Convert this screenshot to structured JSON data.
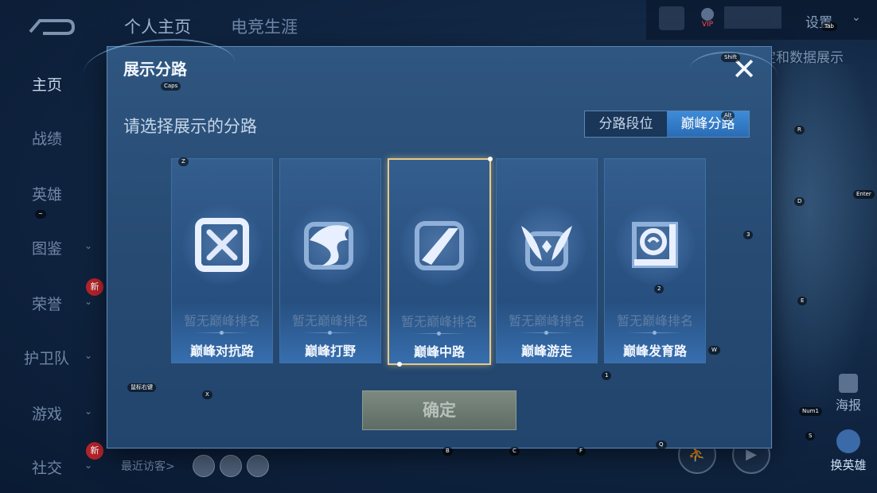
{
  "background": {
    "top_tabs": [
      "个人主页",
      "电竞生涯"
    ],
    "settings_label": "设置",
    "right_snippet": "定和数据展示",
    "sidebar": [
      {
        "label": "主页",
        "active": true,
        "has_chevron": false,
        "new_badge": false
      },
      {
        "label": "战绩",
        "active": false,
        "has_chevron": false,
        "new_badge": false
      },
      {
        "label": "英雄",
        "active": false,
        "has_chevron": false,
        "new_badge": false
      },
      {
        "label": "图鉴",
        "active": false,
        "has_chevron": true,
        "new_badge": false
      },
      {
        "label": "荣誉",
        "active": false,
        "has_chevron": true,
        "new_badge": true
      },
      {
        "label": "护卫队",
        "active": false,
        "has_chevron": true,
        "new_badge": false
      },
      {
        "label": "游戏",
        "active": false,
        "has_chevron": true,
        "new_badge": false
      },
      {
        "label": "社交",
        "active": false,
        "has_chevron": true,
        "new_badge": true
      }
    ],
    "new_badge_text": "新",
    "vip_text": "VIP",
    "visitors_label": "最近访客>",
    "poster_label": "海报",
    "swap_hero_label": "换英雄"
  },
  "dialog": {
    "title": "展示分路",
    "subtitle": "请选择展示的分路",
    "toggle": {
      "options": [
        "分路段位",
        "巅峰分路"
      ],
      "selected_index": 1
    },
    "cards": [
      {
        "name": "巅峰对抗路",
        "rank_text": "暂无巅峰排名",
        "icon": "clash-lane-icon",
        "selected": false
      },
      {
        "name": "巅峰打野",
        "rank_text": "暂无巅峰排名",
        "icon": "jungle-dragon-icon",
        "selected": false
      },
      {
        "name": "巅峰中路",
        "rank_text": "暂无巅峰排名",
        "icon": "mid-lane-icon",
        "selected": true
      },
      {
        "name": "巅峰游走",
        "rank_text": "暂无巅峰排名",
        "icon": "roam-wings-icon",
        "selected": false
      },
      {
        "name": "巅峰发育路",
        "rank_text": "暂无巅峰排名",
        "icon": "farm-lane-icon",
        "selected": false
      }
    ],
    "confirm_label": "确定"
  },
  "key_hints": {
    "tab": "Tab",
    "shift": "Shift",
    "caps": "Caps",
    "alt": "Alt",
    "r": "R",
    "enter": "Enter",
    "d": "D",
    "three": "3",
    "z": "Z",
    "tilde": "~",
    "two": "2",
    "e": "E",
    "w": "W",
    "one": "1",
    "mouse": "鼠标右键",
    "x": "X",
    "num1": "Num1",
    "s": "S",
    "b": "B",
    "c": "C",
    "f": "F",
    "q": "Q"
  },
  "colors": {
    "dialog_bg": "#2a4f78",
    "accent_blue": "#2a6cb5",
    "selected_border": "#e6c987",
    "confirm_bg": "#6f7c74"
  }
}
